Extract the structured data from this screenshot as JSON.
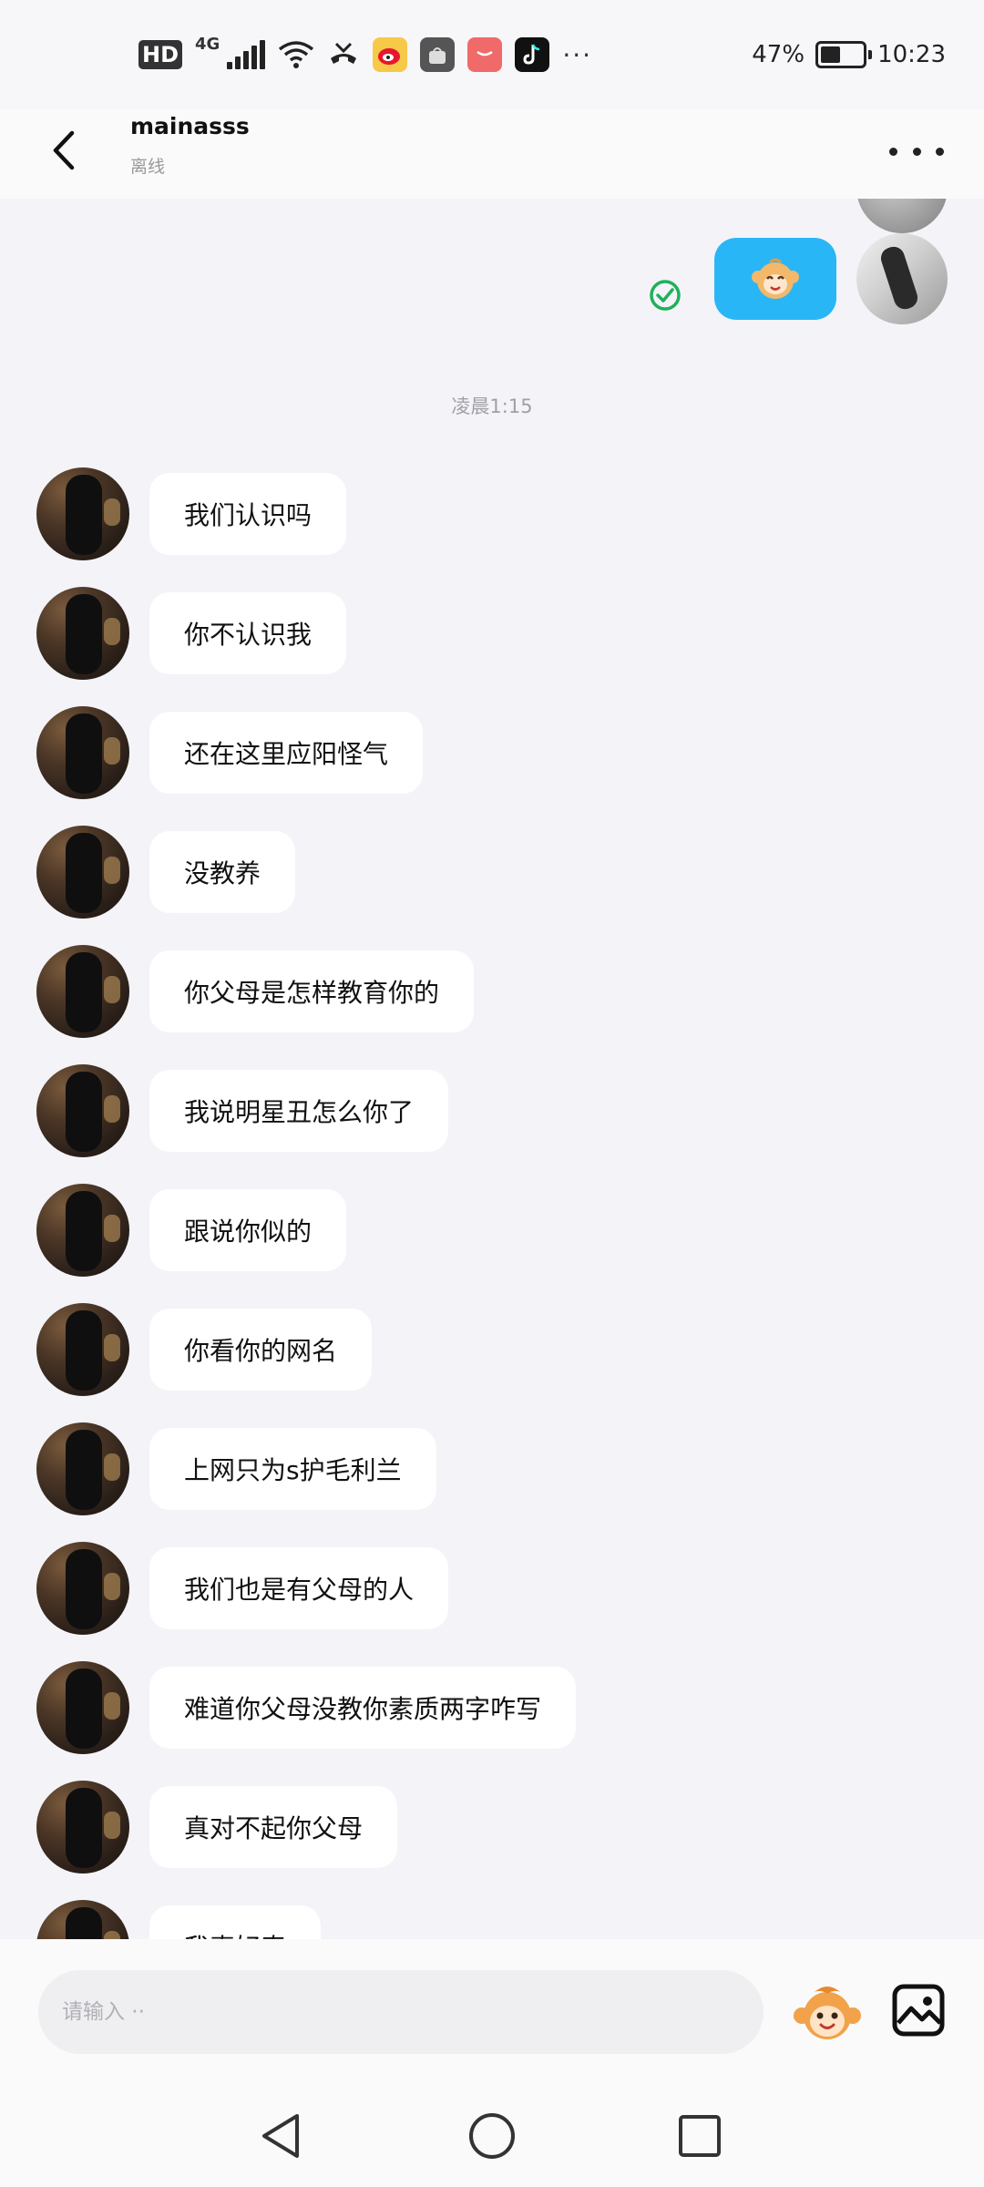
{
  "status_bar": {
    "hd": "HD",
    "network": "4G",
    "more": "···",
    "battery_percent_label": "47%",
    "battery_level": 0.47,
    "time": "10:23"
  },
  "header": {
    "back_icon": "chevron-left-icon",
    "contact_name": "mainasss",
    "contact_status": "离线",
    "more_icon": "more-horizontal-icon"
  },
  "chat": {
    "sent": {
      "type": "sticker",
      "status_icon": "check-circle-icon"
    },
    "timestamp": "凌晨1:15",
    "messages": [
      {
        "text": "我们认识吗"
      },
      {
        "text": "你不认识我"
      },
      {
        "text": "还在这里应阳怪气"
      },
      {
        "text": "没教养"
      },
      {
        "text": "你父母是怎样教育你的"
      },
      {
        "text": "我说明星丑怎么你了"
      },
      {
        "text": "跟说你似的"
      },
      {
        "text": "你看你的网名"
      },
      {
        "text": "上网只为s护毛利兰"
      },
      {
        "text": "我们也是有父母的人"
      },
      {
        "text": "难道你父母没教你素质两字咋写"
      },
      {
        "text": "真对不起你父母"
      },
      {
        "text": "我真好奇"
      }
    ]
  },
  "input_bar": {
    "placeholder": "请输入 ··",
    "emoji_icon": "monkey-emoji-icon",
    "image_icon": "image-icon"
  },
  "nav_bar": {
    "back_icon": "triangle-back-icon",
    "home_icon": "circle-home-icon",
    "recents_icon": "square-recents-icon"
  },
  "colors": {
    "accent_blue": "#29b6f6",
    "check_green": "#1fb05b",
    "background": "#f3f3f8"
  }
}
